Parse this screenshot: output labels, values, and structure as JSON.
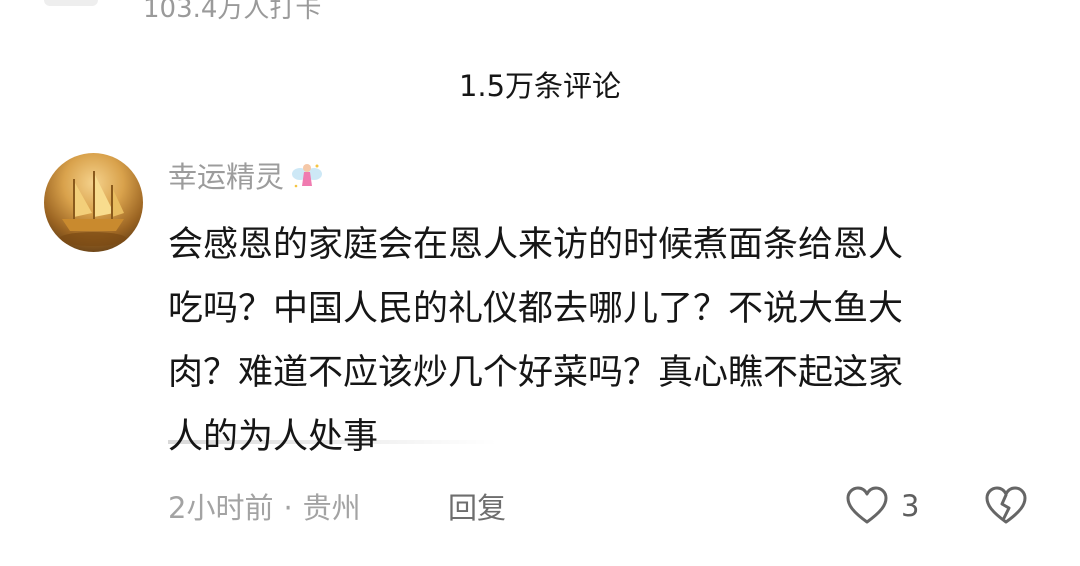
{
  "header": {
    "checkin_text": "103.4万人打卡"
  },
  "comments_section": {
    "count_label": "1.5万条评论"
  },
  "comment": {
    "username": "幸运精灵",
    "content_lines": [
      "会感恩的家庭会在恩人来访的时候煮面条给恩人",
      "吃吗？中国人民的礼仪都去哪儿了？不说大鱼大",
      "肉？难道不应该炒几个好菜吗？真心瞧不起这家",
      "人的为人处事"
    ],
    "time": "2小时前",
    "separator": "·",
    "location": "贵州",
    "reply_label": "回复",
    "like_count": "3",
    "icons": {
      "like": "heart-outline-icon",
      "dislike": "broken-heart-icon",
      "badge": "fairy-icon"
    }
  },
  "colors": {
    "primary_text": "#161616",
    "secondary_text": "#9c9c9c",
    "background": "#ffffff"
  }
}
